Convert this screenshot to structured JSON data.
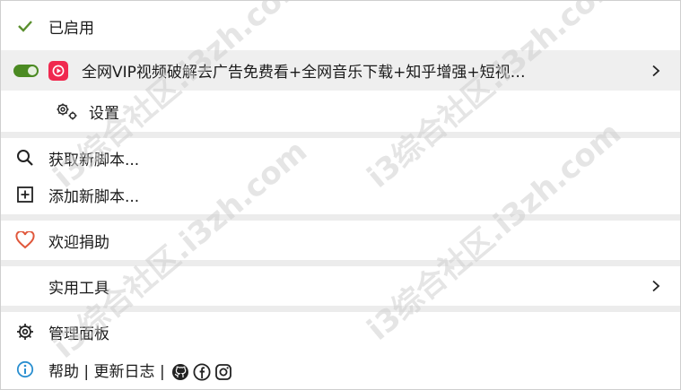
{
  "menu": {
    "enabled_label": "已启用",
    "script": {
      "title": "全网VIP视频破解去广告免费看+全网音乐下载+知乎增强+短视…",
      "settings_label": "设置"
    },
    "get_new_label": "获取新脚本...",
    "add_new_label": "添加新脚本...",
    "donate_label": "欢迎捐助",
    "tools_label": "实用工具",
    "dashboard_label": "管理面板",
    "footer": {
      "help_label": "帮助",
      "divider1": "|",
      "changelog_label": "更新日志",
      "divider2": "|"
    }
  },
  "watermark": {
    "text": "i3综合社区.i3zh.com"
  },
  "colors": {
    "toggle_on": "#4b8a22",
    "check": "#5a8f2e",
    "heart": "#e0573b",
    "info": "#2a8fd0",
    "app_icon": "#f0294f",
    "separator": "#ececec"
  },
  "icons": {
    "enabled": "check-icon",
    "settings": "gear-icon",
    "search": "search-icon",
    "add": "plus-square-icon",
    "donate": "heart-icon",
    "dashboard": "gear-icon",
    "help": "info-icon",
    "github": "github-icon",
    "facebook": "facebook-icon",
    "instagram": "instagram-icon"
  }
}
